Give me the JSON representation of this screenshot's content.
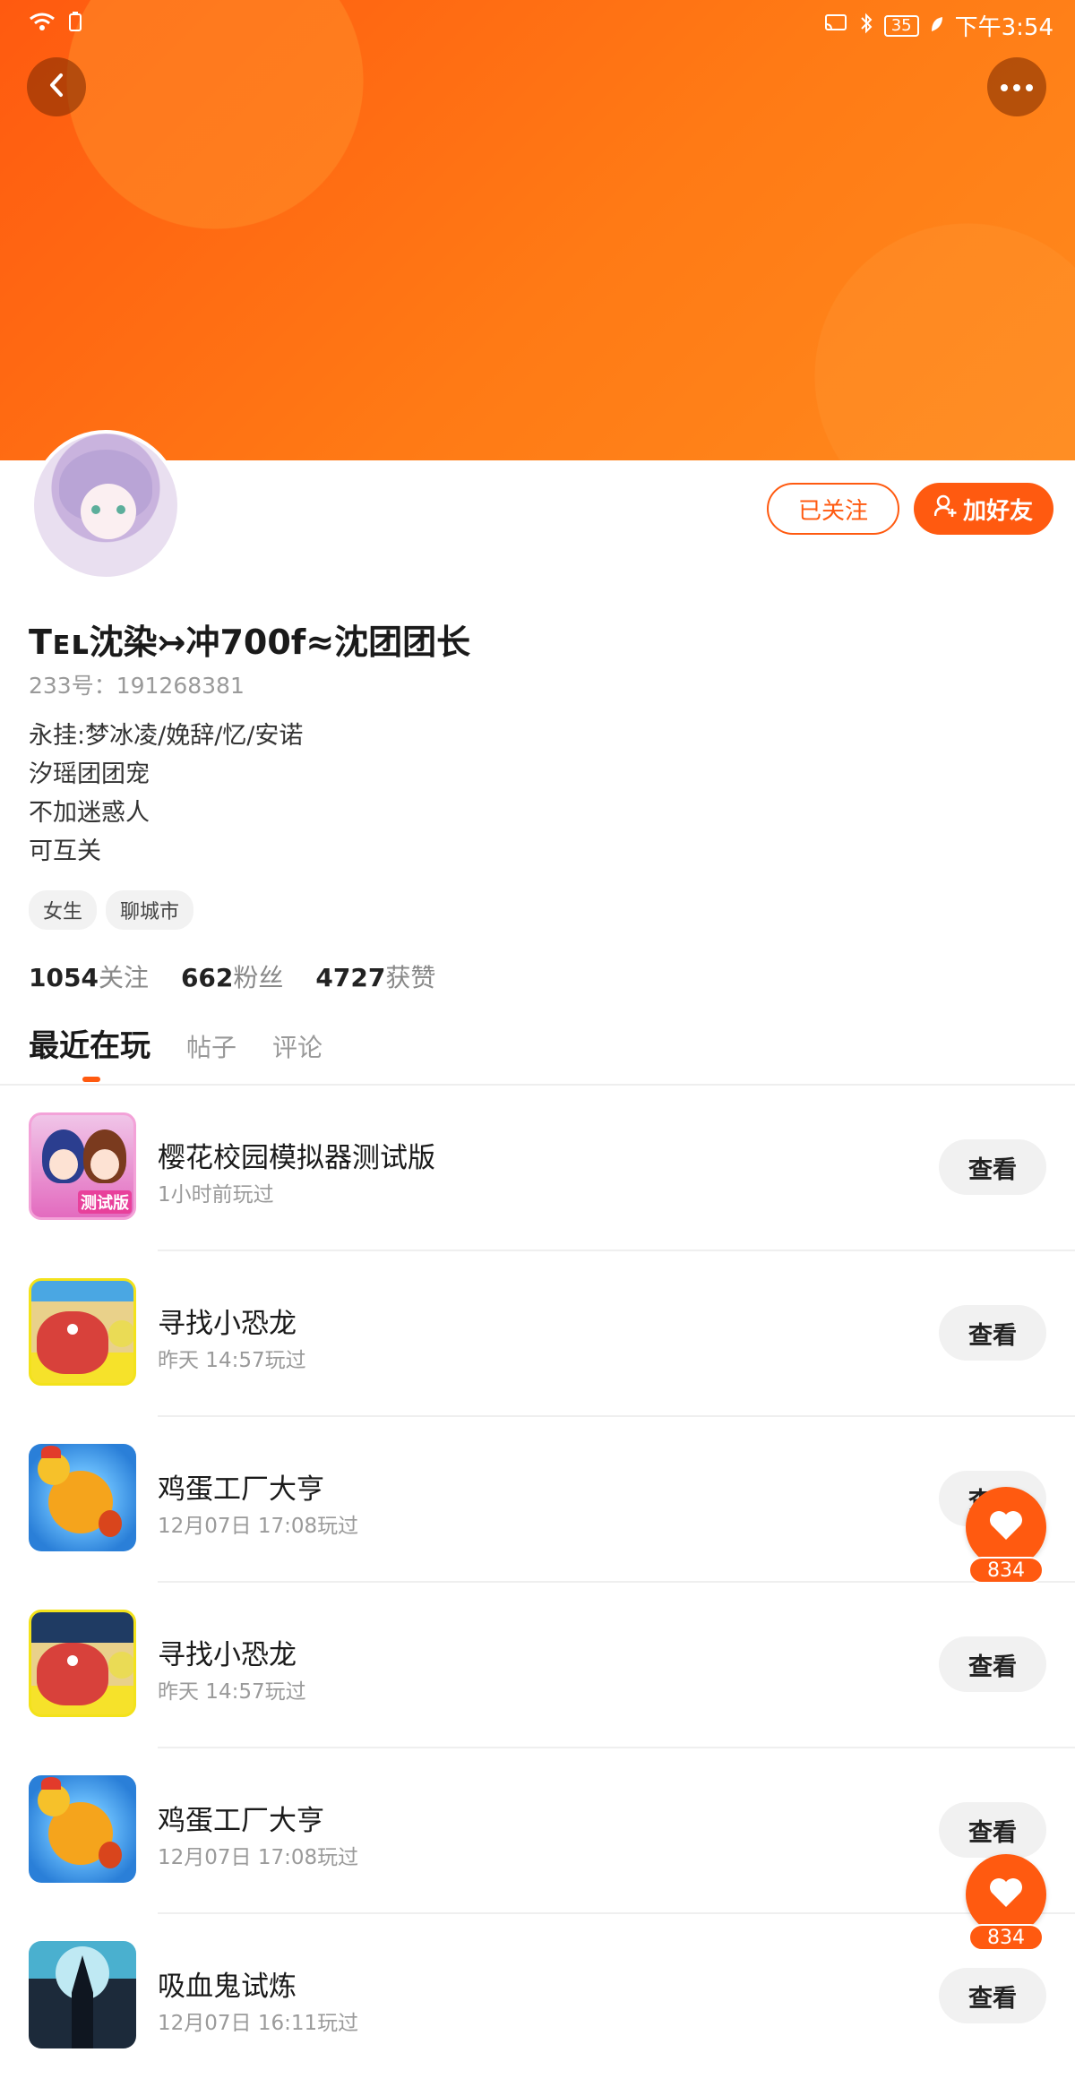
{
  "status_bar": {
    "time": "下午3:54",
    "battery": "35"
  },
  "profile": {
    "name": "Tᴇʟ沈染↣冲700f≈沈团团长",
    "id_line": "233号：191268381",
    "bio": [
      "永挂:梦冰凌/娩辞/忆/安诺",
      "汐瑶团团宠",
      "不加迷惑人",
      "可互关"
    ],
    "tags": [
      "女生",
      "聊城市"
    ]
  },
  "actions": {
    "followed": "已关注",
    "add_friend": "加好友"
  },
  "stats": [
    {
      "value": "1054",
      "label": "关注"
    },
    {
      "value": "662",
      "label": "粉丝"
    },
    {
      "value": "4727",
      "label": "获赞"
    }
  ],
  "tabs": [
    "最近在玩",
    "帖子",
    "评论"
  ],
  "games": [
    {
      "name": "樱花校园模拟器测试版",
      "time": "1小时前玩过",
      "button": "查看",
      "icon": "sakura-school-icon",
      "badge": "测试版"
    },
    {
      "name": "寻找小恐龙",
      "time": "昨天 14:57玩过",
      "button": "查看",
      "icon": "dino-icon"
    },
    {
      "name": "鸡蛋工厂大亨",
      "time": "12月07日 17:08玩过",
      "button": "查看",
      "icon": "chicken-icon"
    },
    {
      "name": "寻找小恐龙",
      "time": "昨天 14:57玩过",
      "button": "查看",
      "icon": "dino-icon"
    },
    {
      "name": "鸡蛋工厂大亨",
      "time": "12月07日 17:08玩过",
      "button": "查看",
      "icon": "chicken-icon"
    },
    {
      "name": "吸血鬼试炼",
      "time": "12月07日 16:11玩过",
      "button": "查看",
      "icon": "vampire-icon"
    }
  ],
  "likes": {
    "count": "834"
  },
  "colors": {
    "accent": "#ff5a10",
    "banner": "#ff7a15"
  }
}
